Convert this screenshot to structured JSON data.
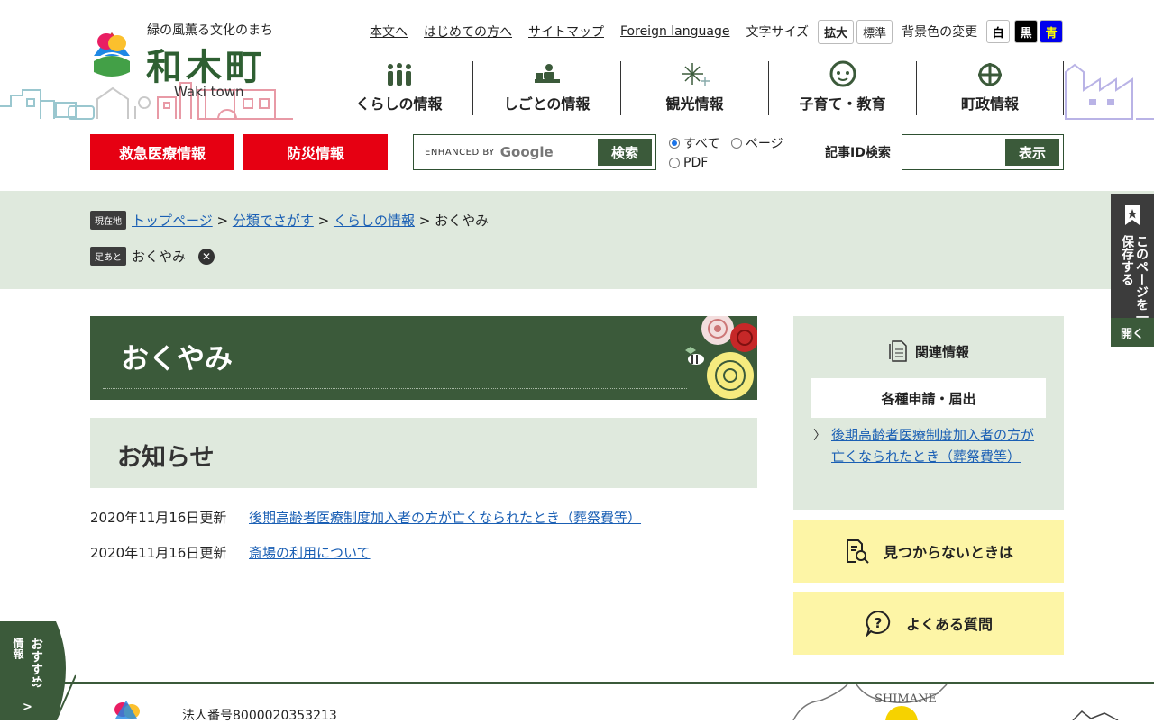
{
  "header": {
    "tagline": "緑の風薫る文化のまち",
    "town_name": "和木町",
    "town_name_en": "Waki town",
    "util_links": [
      "本文へ",
      "はじめての方へ",
      "サイトマップ",
      "Foreign language"
    ],
    "font_size_label": "文字サイズ",
    "font_size_buttons": [
      "拡大",
      "標準"
    ],
    "bg_color_label": "背景色の変更",
    "bg_color_buttons": [
      "白",
      "黒",
      "青"
    ]
  },
  "nav": [
    {
      "label": "くらしの情報",
      "icon": "people-icon"
    },
    {
      "label": "しごとの情報",
      "icon": "worker-desk-icon"
    },
    {
      "label": "観光情報",
      "icon": "fireworks-icon"
    },
    {
      "label": "子育て・教育",
      "icon": "child-face-icon"
    },
    {
      "label": "町政情報",
      "icon": "town-emblem-icon"
    }
  ],
  "emergency": {
    "medical": "救急医療情報",
    "disaster": "防災情報"
  },
  "search": {
    "enhanced_by": "ENHANCED BY",
    "google": "Google",
    "button": "検索",
    "options": [
      "すべて",
      "ページ",
      "PDF"
    ],
    "selected": "すべて"
  },
  "article_id": {
    "label": "記事ID検索",
    "button": "表示"
  },
  "breadcrumb": {
    "current_tag": "現在地",
    "items": [
      "トップページ",
      "分類でさがす",
      "くらしの情報"
    ],
    "current": "おくやみ",
    "history_tag": "足あと",
    "history_item": "おくやみ"
  },
  "side_tab": {
    "label": "このページを一時保存する",
    "open": "開く"
  },
  "page_title": "おくやみ",
  "section_title": "お知らせ",
  "news": [
    {
      "date": "2020年11月16日更新",
      "title": "後期高齢者医療制度加入者の方が亡くなられたとき（葬祭費等）"
    },
    {
      "date": "2020年11月16日更新",
      "title": "斎場の利用について"
    }
  ],
  "related": {
    "heading": "関連情報",
    "category": "各種申請・届出",
    "link": "後期高齢者医療制度加入者の方が亡くなられたとき（葬祭費等）"
  },
  "help": {
    "not_found": "見つからないときは",
    "faq": "よくある質問"
  },
  "recommend": {
    "label": "おすすめ",
    "sub": "情報",
    "arrow": ">"
  },
  "footer": {
    "corp_number": "法人番号8000020353213",
    "map_label": "SHIMANE"
  },
  "colors": {
    "green": "#3b5a3a",
    "red": "#e60012",
    "mint": "#dfe9dd",
    "yellow": "#fdf5a6"
  }
}
